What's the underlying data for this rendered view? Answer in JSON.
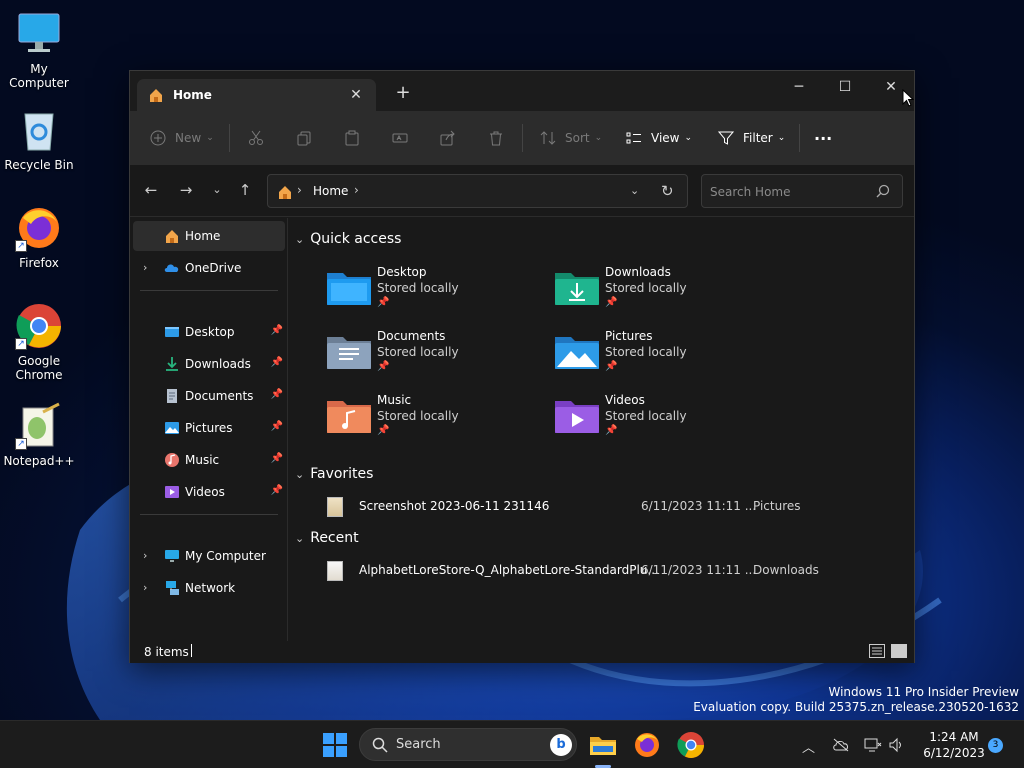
{
  "desktop": {
    "icons": [
      {
        "label": "My Computer",
        "icon": "monitor-icon"
      },
      {
        "label": "Recycle Bin",
        "icon": "recycle-bin-icon"
      },
      {
        "label": "Firefox",
        "icon": "firefox-icon"
      },
      {
        "label": "Google Chrome",
        "icon": "chrome-icon"
      },
      {
        "label": "Notepad++",
        "icon": "notepadpp-icon"
      }
    ]
  },
  "window": {
    "tab_title": "Home",
    "new_tab_glyph": "+",
    "controls": {
      "minimize": "─",
      "maximize": "☐",
      "close": "✕"
    }
  },
  "toolbar": {
    "new_label": "New",
    "sort_label": "Sort",
    "view_label": "View",
    "filter_label": "Filter",
    "more_label": "···"
  },
  "address": {
    "crumb": "Home",
    "search_placeholder": "Search Home"
  },
  "navpane": {
    "home": "Home",
    "onedrive": "OneDrive",
    "pinned": [
      {
        "label": "Desktop",
        "icon": "desktop-icon"
      },
      {
        "label": "Downloads",
        "icon": "downloads-icon"
      },
      {
        "label": "Documents",
        "icon": "documents-icon"
      },
      {
        "label": "Pictures",
        "icon": "pictures-icon"
      },
      {
        "label": "Music",
        "icon": "music-icon"
      },
      {
        "label": "Videos",
        "icon": "videos-icon"
      }
    ],
    "my_computer": "My Computer",
    "network": "Network"
  },
  "quick_access": {
    "header": "Quick access",
    "tiles": [
      {
        "name": "Desktop",
        "sub": "Stored locally",
        "color": "#1e9bf0"
      },
      {
        "name": "Downloads",
        "sub": "Stored locally",
        "color": "#1fb58f"
      },
      {
        "name": "Documents",
        "sub": "Stored locally",
        "color": "#8da3bd"
      },
      {
        "name": "Pictures",
        "sub": "Stored locally",
        "color": "#2d9be8"
      },
      {
        "name": "Music",
        "sub": "Stored locally",
        "color": "#f08a5d"
      },
      {
        "name": "Videos",
        "sub": "Stored locally",
        "color": "#9b5de5"
      }
    ]
  },
  "favorites": {
    "header": "Favorites",
    "rows": [
      {
        "name": "Screenshot 2023-06-11 231146",
        "date": "6/11/2023 11:11 ...",
        "location": "Pictures"
      }
    ]
  },
  "recent": {
    "header": "Recent",
    "rows": [
      {
        "name": "AlphabetLoreStore-Q_AlphabetLore-StandardPlu...",
        "date": "6/11/2023 11:11 ...",
        "location": "Downloads"
      }
    ]
  },
  "status": {
    "items": "8 items"
  },
  "watermark": {
    "line1": "Windows 11 Pro Insider Preview",
    "line2": "Evaluation copy. Build 25375.zn_release.230520-1632"
  },
  "taskbar": {
    "search_label": "Search",
    "time": "1:24 AM",
    "date": "6/12/2023",
    "notifications": "3"
  }
}
